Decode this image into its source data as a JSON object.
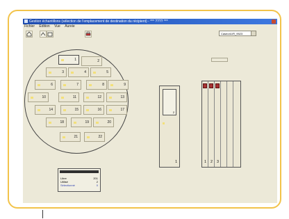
{
  "window": {
    "title": "Gestion échantillons (sélection de l'emplacement de destination du récipient) - *** ???? ***"
  },
  "menu": [
    "Fichier",
    "Edition",
    "Vue",
    "Aureie"
  ],
  "toolbar": {
    "combo_value": "Caseon1/R_9523"
  },
  "wafer": {
    "dies": [
      {
        "label": "1",
        "selected": true
      },
      {
        "label": "2"
      },
      {
        "label": "3"
      },
      {
        "label": "4"
      },
      {
        "label": "5"
      },
      {
        "label": "6"
      },
      {
        "label": "7"
      },
      {
        "label": "8"
      },
      {
        "label": "9"
      },
      {
        "label": "10"
      },
      {
        "label": "11"
      },
      {
        "label": "12"
      },
      {
        "label": "13"
      },
      {
        "label": "14"
      },
      {
        "label": "15"
      },
      {
        "label": "16"
      },
      {
        "label": "17"
      },
      {
        "label": "18"
      },
      {
        "label": "19"
      },
      {
        "label": "20"
      },
      {
        "label": "21"
      },
      {
        "label": "22"
      }
    ]
  },
  "slot": {
    "inner_label": "2",
    "bottom_label": "1"
  },
  "rack": {
    "columns": [
      "1",
      "2",
      "3",
      "",
      "",
      ""
    ],
    "tubes_in_columns": 3
  },
  "info": {
    "rows": [
      {
        "label": "Libre",
        "value": "201"
      },
      {
        "label": "Utilisé",
        "value": "2"
      },
      {
        "label": "Sélectionné",
        "value": "0"
      }
    ]
  },
  "colors": {
    "frame": "#f2c34a",
    "titlebar": "#1f4db0",
    "tube": "#a83232",
    "marker": "#f3e07a"
  }
}
